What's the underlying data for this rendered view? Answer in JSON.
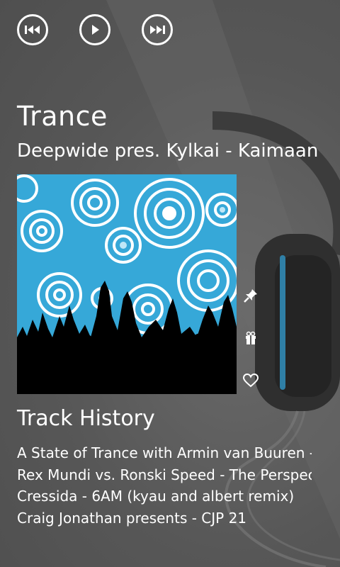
{
  "player": {
    "controls": [
      {
        "name": "previous-button",
        "icon": "skip-previous-icon"
      },
      {
        "name": "play-button",
        "icon": "play-icon"
      },
      {
        "name": "next-button",
        "icon": "skip-next-icon"
      }
    ]
  },
  "station": {
    "title": "Trance",
    "now_playing": "Deepwide pres. Kylkai - Kaimaan"
  },
  "actions": [
    {
      "name": "pin-button",
      "icon": "pin-icon"
    },
    {
      "name": "gift-button",
      "icon": "gift-icon"
    },
    {
      "name": "favorite-button",
      "icon": "heart-icon"
    }
  ],
  "history": {
    "title": "Track History",
    "tracks": [
      "A State of Trance with Armin van Buuren - T",
      "Rex Mundi vs. Ronski Speed - The Perspect",
      "Cressida - 6AM (kyau and albert remix)",
      "Craig Jonathan presents - CJP 21"
    ]
  },
  "colors": {
    "background": "#5b5b5b",
    "text": "#ffffff",
    "album_blue": "#36a8d8"
  }
}
